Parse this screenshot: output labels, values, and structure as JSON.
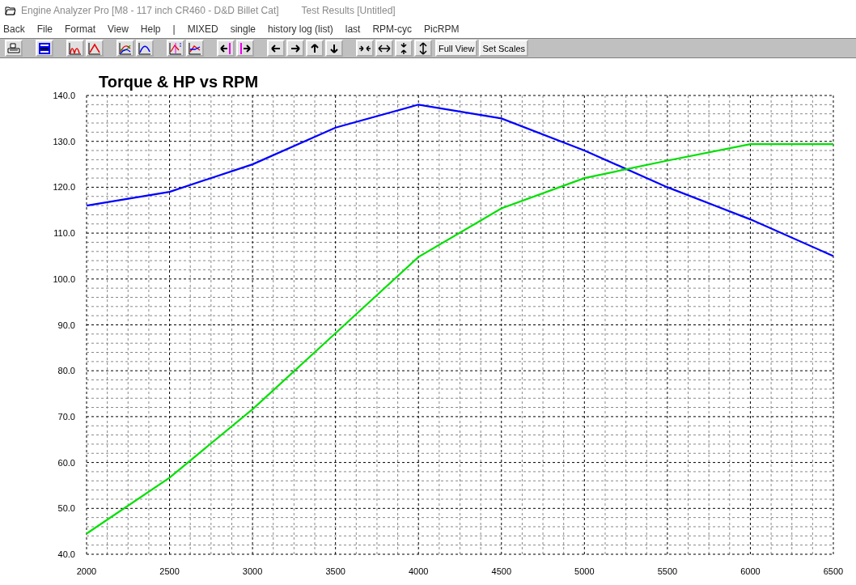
{
  "window": {
    "title": "Engine Analyzer Pro [M8 - 117 inch CR460 - D&D Billet Cat]",
    "subtitle": "Test Results [Untitled]"
  },
  "menu": [
    "Back",
    "File",
    "Format",
    "View",
    "Help",
    "|",
    "MIXED",
    "single",
    "history log (list)",
    "last",
    "RPM-cyc",
    "PicRPM"
  ],
  "toolbar": {
    "text_buttons": [
      "Full View",
      "Set Scales"
    ]
  },
  "chart": {
    "chart_data": {
      "type": "line",
      "title": "Torque & HP vs RPM",
      "x": [
        2000,
        2500,
        3000,
        3500,
        4000,
        4500,
        5000,
        5500,
        6000,
        6500
      ],
      "series": [
        {
          "color": "#0000ff",
          "values": [
            116,
            119,
            125,
            133,
            138,
            135,
            128,
            120,
            113,
            105
          ]
        },
        {
          "color": "#00e000",
          "values": [
            44.5,
            56.7,
            71.6,
            88.2,
            104.8,
            115.4,
            122,
            125.8,
            129.4,
            129.4
          ]
        }
      ],
      "grid": true,
      "xlim": [
        2000,
        6500
      ],
      "ylim": [
        40,
        140
      ],
      "xticks": [
        2000,
        2500,
        3000,
        3500,
        4000,
        4500,
        5000,
        5500,
        6000,
        6500
      ],
      "yticks": [
        {
          "value": 40,
          "label": "40.0"
        },
        {
          "value": 50,
          "label": "50.0"
        },
        {
          "value": 60,
          "label": "60.0"
        },
        {
          "value": 70,
          "label": "70.0"
        },
        {
          "value": 80,
          "label": "80.0"
        },
        {
          "value": 90,
          "label": "90.0"
        },
        {
          "value": 100,
          "label": "100.0"
        },
        {
          "value": 110,
          "label": "110.0"
        },
        {
          "value": 120,
          "label": "120.0"
        },
        {
          "value": 130,
          "label": "130.0"
        },
        {
          "value": 140,
          "label": "140.0"
        }
      ]
    }
  }
}
